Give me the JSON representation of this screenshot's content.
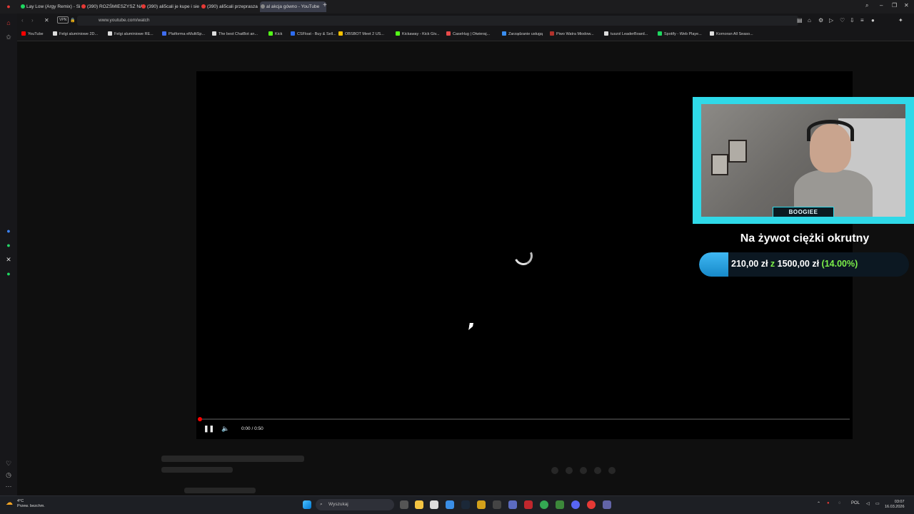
{
  "browser": {
    "tabs": [
      {
        "label": "Lay Low (Argy Remix) - Si"
      },
      {
        "label": "(390) ROZŚMIESZYSZ NA"
      },
      {
        "label": "(390) ali5cali je kupe i sie"
      },
      {
        "label": "(390) ali5cali przeprasza"
      },
      {
        "label": "al akcja gówno - YouTube"
      }
    ],
    "url": "www.youtube.com/watch",
    "vpn_label": "VPN",
    "bookmarks": [
      {
        "label": "YouTube",
        "color": "#ff0000"
      },
      {
        "label": "Felgi aluminiowe 2D...",
        "color": "#dddddd"
      },
      {
        "label": "Felgi aluminiowe RE...",
        "color": "#dddddd"
      },
      {
        "label": "Platforma eMultiSp...",
        "color": "#3f6df0"
      },
      {
        "label": "The best ChatBot an...",
        "color": "#dddddd"
      },
      {
        "label": "Kick",
        "color": "#53fc18"
      },
      {
        "label": "CSFloat - Buy & Sell...",
        "color": "#2d6cf0"
      },
      {
        "label": "OBSBOT Meet 2 US...",
        "color": "#f5c000"
      },
      {
        "label": "Kickaway - Kick Giv...",
        "color": "#53fc18"
      },
      {
        "label": "CaseHug | Otwieraj...",
        "color": "#e84a4a"
      },
      {
        "label": "Zarządzanie usługą",
        "color": "#3a8ef0"
      },
      {
        "label": "Piwo Watra Miodow...",
        "color": "#b2322c"
      },
      {
        "label": "tuszol LeaderBoard...",
        "color": "#dddddd"
      },
      {
        "label": "Spotify - Web Playe...",
        "color": "#1ed760"
      },
      {
        "label": "Kornoran All Seaso...",
        "color": "#dddddd"
      }
    ]
  },
  "player": {
    "time": "0:00 / 0:50",
    "progress_fraction": 0.0
  },
  "overlay": {
    "streamer_name": "BOOGIEE",
    "goal_title": "Na żywot ciężki okrutny",
    "goal_current": "210,00 zł",
    "goal_sep": "z",
    "goal_target": "1500,00 zł",
    "goal_percent": "(14.00%)",
    "goal_fraction": 0.14
  },
  "taskbar": {
    "weather_temp": "4°C",
    "weather_desc": "Przew. bezchm.",
    "search_placeholder": "Wyszukaj",
    "lang": "POL",
    "time": "03:07",
    "date": "16.03.2026"
  }
}
